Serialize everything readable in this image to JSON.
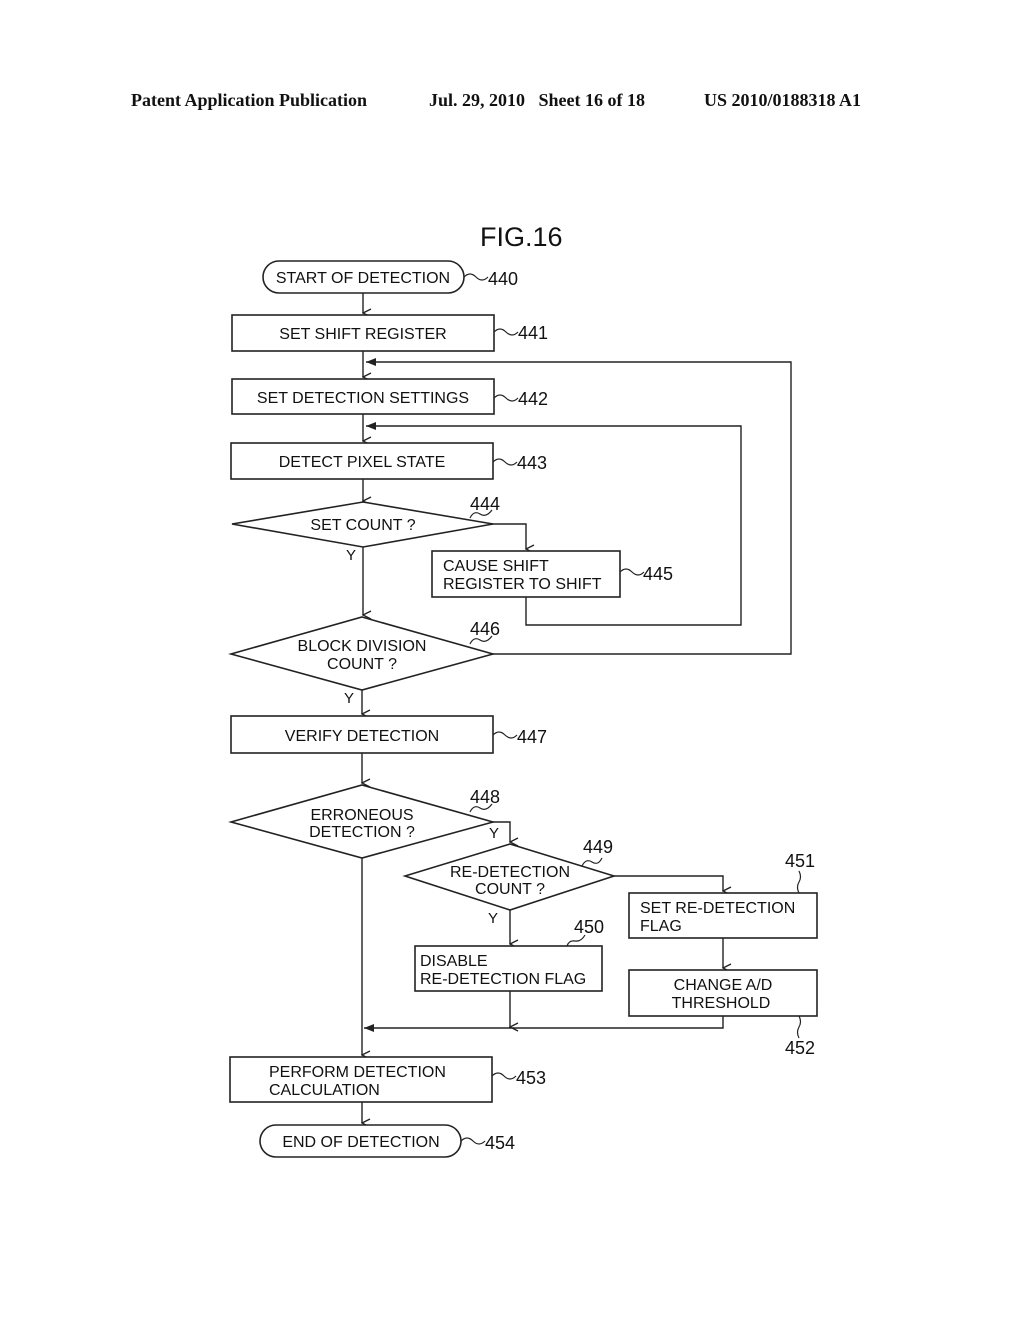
{
  "header": {
    "left": "Patent Application Publication",
    "date_sheet": "Jul. 29, 2010   Sheet 16 of 18",
    "pub_number": "US 2010/0188318 A1"
  },
  "figure": {
    "title": "FIG.16",
    "nodes": {
      "n440": {
        "ref": "440",
        "type": "terminal",
        "lines": [
          "START OF DETECTION"
        ]
      },
      "n441": {
        "ref": "441",
        "type": "process",
        "lines": [
          "SET SHIFT REGISTER"
        ]
      },
      "n442": {
        "ref": "442",
        "type": "process",
        "lines": [
          "SET DETECTION SETTINGS"
        ]
      },
      "n443": {
        "ref": "443",
        "type": "process",
        "lines": [
          "DETECT PIXEL STATE"
        ]
      },
      "n444": {
        "ref": "444",
        "type": "decision",
        "lines": [
          "SET COUNT ?"
        ]
      },
      "n445": {
        "ref": "445",
        "type": "process",
        "lines": [
          "CAUSE SHIFT",
          "REGISTER TO SHIFT"
        ]
      },
      "n446": {
        "ref": "446",
        "type": "decision",
        "lines": [
          "BLOCK DIVISION",
          "COUNT ?"
        ]
      },
      "n447": {
        "ref": "447",
        "type": "process",
        "lines": [
          "VERIFY DETECTION"
        ]
      },
      "n448": {
        "ref": "448",
        "type": "decision",
        "lines": [
          "ERRONEOUS",
          "DETECTION ?"
        ]
      },
      "n449": {
        "ref": "449",
        "type": "decision",
        "lines": [
          "RE-DETECTION",
          "COUNT ?"
        ]
      },
      "n450": {
        "ref": "450",
        "type": "process",
        "lines": [
          "DISABLE",
          "RE-DETECTION FLAG"
        ]
      },
      "n451": {
        "ref": "451",
        "type": "process",
        "lines": [
          "SET RE-DETECTION",
          "FLAG"
        ]
      },
      "n452": {
        "ref": "452",
        "type": "process",
        "lines": [
          "CHANGE A/D",
          "THRESHOLD"
        ]
      },
      "n453": {
        "ref": "453",
        "type": "process",
        "lines": [
          "PERFORM DETECTION",
          "CALCULATION"
        ]
      },
      "n454": {
        "ref": "454",
        "type": "terminal",
        "lines": [
          "END OF DETECTION"
        ]
      }
    },
    "branch_labels": {
      "yes": "Y"
    },
    "edges": [
      {
        "from": "440",
        "to": "441"
      },
      {
        "from": "441",
        "to": "442"
      },
      {
        "from": "442",
        "to": "443"
      },
      {
        "from": "443",
        "to": "444"
      },
      {
        "from": "444",
        "to": "446",
        "label": "Y"
      },
      {
        "from": "444",
        "to": "445"
      },
      {
        "from": "445",
        "to": "443"
      },
      {
        "from": "446",
        "to": "447",
        "label": "Y"
      },
      {
        "from": "446",
        "to": "442"
      },
      {
        "from": "447",
        "to": "448"
      },
      {
        "from": "448",
        "to": "449",
        "label": "Y"
      },
      {
        "from": "448",
        "to": "453"
      },
      {
        "from": "449",
        "to": "450",
        "label": "Y"
      },
      {
        "from": "449",
        "to": "451"
      },
      {
        "from": "450",
        "to": "453"
      },
      {
        "from": "451",
        "to": "452"
      },
      {
        "from": "452",
        "to": "453"
      },
      {
        "from": "453",
        "to": "454"
      }
    ]
  }
}
